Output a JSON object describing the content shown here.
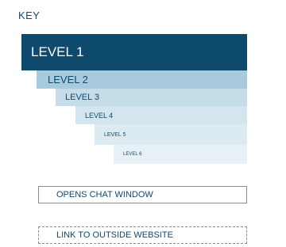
{
  "key": {
    "title": "KEY"
  },
  "levels": [
    {
      "label": "LEVEL 1"
    },
    {
      "label": "LEVEL 2"
    },
    {
      "label": "LEVEL 3"
    },
    {
      "label": "LEVEL 4"
    },
    {
      "label": "LEVEL 5"
    },
    {
      "label": "LEVEL 6"
    }
  ],
  "legend": {
    "chat_window": "OPENS CHAT WINDOW",
    "outside_link": "LINK TO OUTSIDE WEBSITE"
  },
  "colors": {
    "primary": "#0e4a6e",
    "level2": "#a8cadf",
    "level3": "#c5dce9",
    "level4": "#d3e5ef",
    "level5": "#dceaf2",
    "level6": "#e7f0f6"
  }
}
